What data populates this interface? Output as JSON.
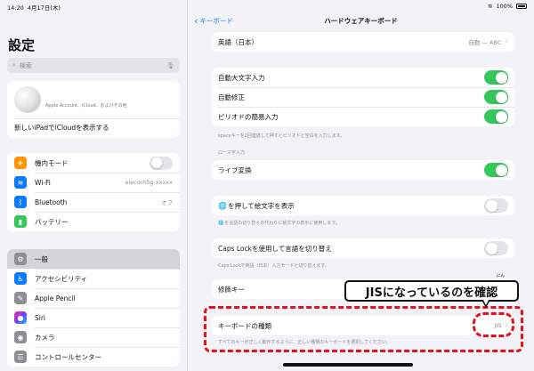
{
  "status": {
    "time": "14:20",
    "date": "4月17日(木)",
    "battery": "100%"
  },
  "sidebar": {
    "title": "設定",
    "search_placeholder": "検索",
    "account": {
      "sub": "Apple Account、iCloud、およびその他",
      "icloud_row": "新しいiPadでiCloudを表示する"
    },
    "group1": [
      {
        "label": "機内モード",
        "icon": "airplane-icon",
        "color": "#ff9500"
      },
      {
        "label": "Wi-Fi",
        "icon": "wifi-icon",
        "color": "#0a7aff",
        "value": "elecom5g-xxxxx"
      },
      {
        "label": "Bluetooth",
        "icon": "bluetooth-icon",
        "color": "#0a7aff",
        "value": "オフ"
      },
      {
        "label": "バッテリー",
        "icon": "battery-icon",
        "color": "#34c759"
      }
    ],
    "group2": [
      {
        "label": "一般",
        "icon": "gear-icon",
        "color": "#8e8e93"
      },
      {
        "label": "アクセシビリティ",
        "icon": "accessibility-icon",
        "color": "#0a7aff"
      },
      {
        "label": "Apple Pencil",
        "icon": "pencil-icon",
        "color": "#8e8e93"
      },
      {
        "label": "Siri",
        "icon": "siri-icon",
        "color": "#222222"
      },
      {
        "label": "カメラ",
        "icon": "camera-icon",
        "color": "#8e8e93"
      },
      {
        "label": "コントロールセンター",
        "icon": "control-center-icon",
        "color": "#8e8e93"
      }
    ]
  },
  "main": {
    "back_label": "キーボード",
    "title": "ハードウェアキーボード",
    "lang_row": {
      "label": "英語（日本）",
      "value": "自動 — ABC"
    },
    "toggles1": [
      {
        "label": "自動大文字入力",
        "on": true
      },
      {
        "label": "自動修正",
        "on": true
      },
      {
        "label": "ピリオドの簡易入力",
        "on": true
      }
    ],
    "note1": "spaceキーを2回連続して押すとピリオドと空白を入力します。",
    "romaji_header": "ローマ字入力",
    "live_convert": {
      "label": "ライブ変換",
      "on": true
    },
    "emoji_row": {
      "label": "を押して絵文字を表示",
      "on": false
    },
    "note2": "を言語の切り替えの代わりに絵文字の表示に使用します。",
    "caps_row": {
      "label": "Caps Lockを使用して言語を切り替え",
      "on": false
    },
    "note3": "Caps Lockで英語（日本）入力モードと切り替えます。",
    "modifier_label": "修飾キー",
    "kbd_type": {
      "label": "キーボードの種類",
      "value": "JIS"
    },
    "note4": "すべてのキーが正しく動作するように、正しい種類のキーボードを選択してください。"
  },
  "overlay": {
    "callout": "JISになっているのを確認",
    "ruby": "にん"
  }
}
